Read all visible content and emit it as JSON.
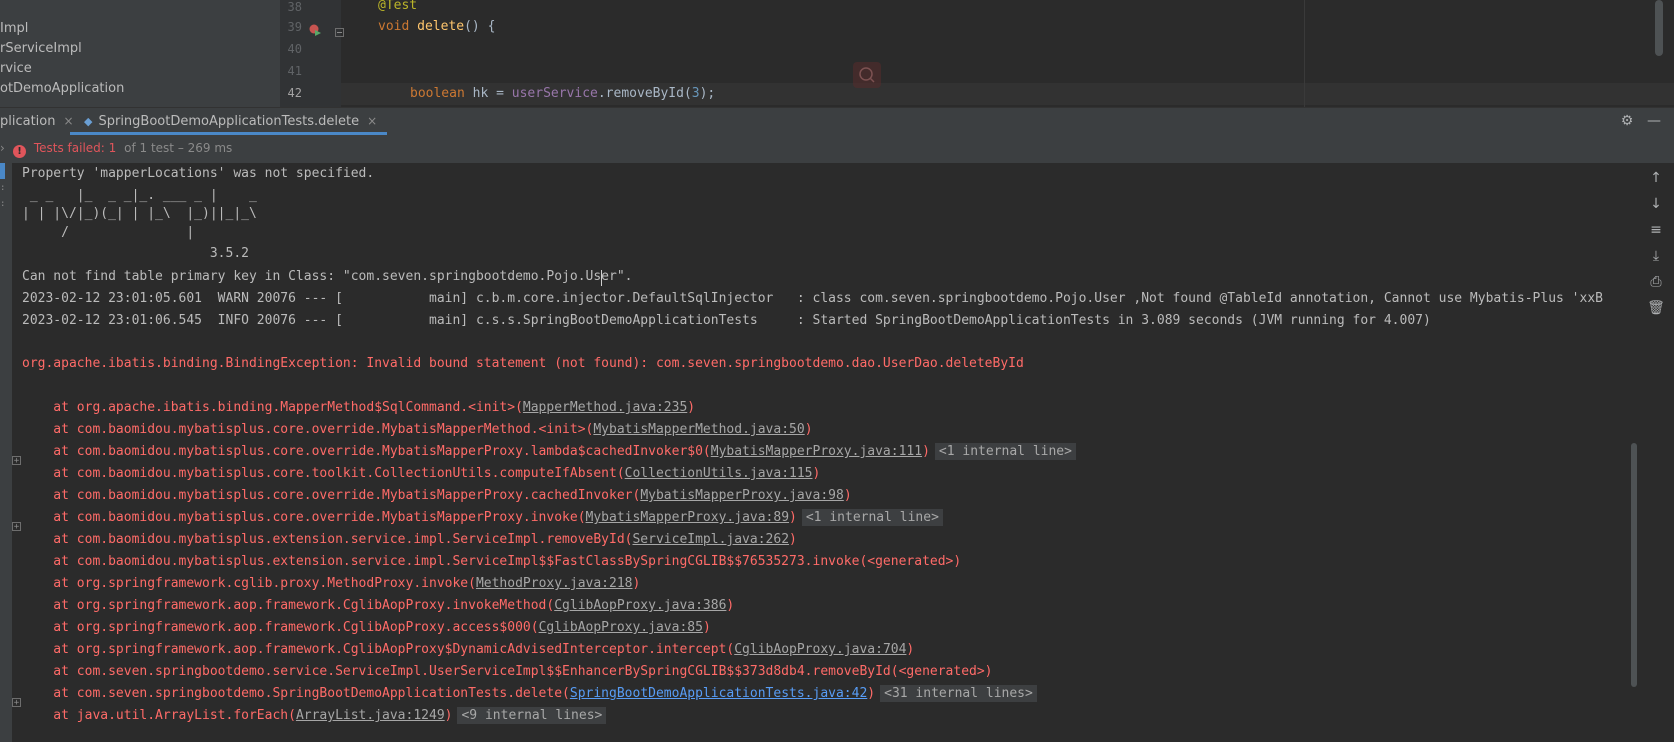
{
  "project_tree": {
    "items": [
      "Impl",
      "rServiceImpl",
      "rvice",
      "otDemoApplication",
      ""
    ]
  },
  "editor": {
    "line_numbers": [
      "38",
      "39",
      "40",
      "41",
      "42"
    ],
    "lines": {
      "l38": {
        "annotation": "@Test"
      },
      "l39": {
        "kw": "void",
        "fn": "delete",
        "rest": "() {"
      },
      "l42": {
        "kw": "boolean",
        "var": " hk = ",
        "field": "userService",
        "call": ".removeById(",
        "num": "3",
        "end": ");"
      }
    }
  },
  "tabs": {
    "first": "plication",
    "active": "SpringBootDemoApplicationTests.delete",
    "close": "×"
  },
  "status": {
    "failed_label": "Tests failed:",
    "failed_count": "1",
    "detail": "of 1 test – 269 ms"
  },
  "console": {
    "lines": [
      "Property 'mapperLocations' was not specified.",
      " _ _   |_  _ _|_. ___ _ |    _ ",
      "| | |\\/|_)(_| | |_\\  |_)||_|_\\ ",
      "     /               |         ",
      "                        3.5.2 ",
      "Can not find table primary key in Class: \"com.seven.springbootdemo.Pojo.User\".",
      "2023-02-12 23:01:05.601  WARN 20076 --- [           main] c.b.m.core.injector.DefaultSqlInjector   : class com.seven.springbootdemo.Pojo.User ,Not found @TableId annotation, Cannot use Mybatis-Plus 'xxB",
      "2023-02-12 23:01:06.545  INFO 20076 --- [           main] c.s.s.SpringBootDemoApplicationTests     : Started SpringBootDemoApplicationTests in 3.089 seconds (JVM running for 4.007)"
    ],
    "exception": "org.apache.ibatis.binding.BindingException: Invalid bound statement (not found): com.seven.springbootdemo.dao.UserDao.deleteById",
    "stack": [
      {
        "pre": "    at org.apache.ibatis.binding.MapperMethod$SqlCommand.<init>(",
        "link": "MapperMethod.java:235",
        "post": ")",
        "internal": ""
      },
      {
        "pre": "    at com.baomidou.mybatisplus.core.override.MybatisMapperMethod.<init>(",
        "link": "MybatisMapperMethod.java:50",
        "post": ")",
        "internal": ""
      },
      {
        "pre": "    at com.baomidou.mybatisplus.core.override.MybatisMapperProxy.lambda$cachedInvoker$0(",
        "link": "MybatisMapperProxy.java:111",
        "post": ")",
        "internal": "<1 internal line>"
      },
      {
        "pre": "    at com.baomidou.mybatisplus.core.toolkit.CollectionUtils.computeIfAbsent(",
        "link": "CollectionUtils.java:115",
        "post": ")",
        "internal": ""
      },
      {
        "pre": "    at com.baomidou.mybatisplus.core.override.MybatisMapperProxy.cachedInvoker(",
        "link": "MybatisMapperProxy.java:98",
        "post": ")",
        "internal": ""
      },
      {
        "pre": "    at com.baomidou.mybatisplus.core.override.MybatisMapperProxy.invoke(",
        "link": "MybatisMapperProxy.java:89",
        "post": ")",
        "internal": "<1 internal line>"
      },
      {
        "pre": "    at com.baomidou.mybatisplus.extension.service.impl.ServiceImpl.removeById(",
        "link": "ServiceImpl.java:262",
        "post": ")",
        "internal": ""
      },
      {
        "pre": "    at com.baomidou.mybatisplus.extension.service.impl.ServiceImpl$$FastClassBySpringCGLIB$$76535273.invoke(<generated>)",
        "link": "",
        "post": "",
        "internal": ""
      },
      {
        "pre": "    at org.springframework.cglib.proxy.MethodProxy.invoke(",
        "link": "MethodProxy.java:218",
        "post": ")",
        "internal": ""
      },
      {
        "pre": "    at org.springframework.aop.framework.CglibAopProxy.invokeMethod(",
        "link": "CglibAopProxy.java:386",
        "post": ")",
        "internal": ""
      },
      {
        "pre": "    at org.springframework.aop.framework.CglibAopProxy.access$000(",
        "link": "CglibAopProxy.java:85",
        "post": ")",
        "internal": ""
      },
      {
        "pre": "    at org.springframework.aop.framework.CglibAopProxy$DynamicAdvisedInterceptor.intercept(",
        "link": "CglibAopProxy.java:704",
        "post": ")",
        "internal": ""
      },
      {
        "pre": "    at com.seven.springbootdemo.service.ServiceImpl.UserServiceImpl$$EnhancerBySpringCGLIB$$373d8db4.removeById(<generated>)",
        "link": "",
        "post": "",
        "internal": ""
      },
      {
        "pre": "    at com.seven.springbootdemo.SpringBootDemoApplicationTests.delete(",
        "link": "SpringBootDemoApplicationTests.java:42",
        "post": ")",
        "internal": "<31 internal lines>"
      },
      {
        "pre": "    at java.util.ArrayList.forEach(",
        "link": "ArrayList.java:1249",
        "post": ")",
        "internal": "<9 internal lines>"
      }
    ]
  },
  "colors": {
    "error": "#ff6b68",
    "accent": "#4a88c7",
    "fail": "#e0555b"
  }
}
